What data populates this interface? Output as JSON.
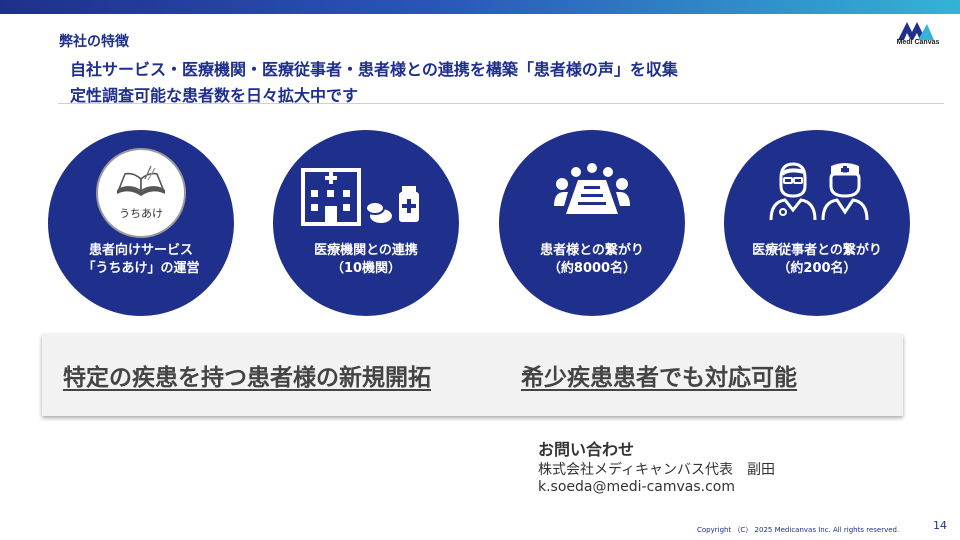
{
  "header": {
    "section_label": "弊社の特徴",
    "headline_line1": "自社サービス・医療機関・医療従事者・患者様との連携を構築「患者様の声」を収集",
    "headline_line2": "定性調査可能な患者数を日々拡大中です",
    "logo_text": "Medi Canvas"
  },
  "features": [
    {
      "label_line1": "患者向けサービス",
      "label_line2": "「うちあけ」の運営",
      "badge_text": "うちあけ",
      "icon": "book-icon"
    },
    {
      "label_line1": "医療機関との連携",
      "label_line2": "（10機関）",
      "icon": "hospital-icon"
    },
    {
      "label_line1": "患者様との繋がり",
      "label_line2": "（約8000名）",
      "icon": "meeting-icon"
    },
    {
      "label_line1": "医療従事者との繋がり",
      "label_line2": "（約200名）",
      "icon": "doctor-nurse-icon"
    }
  ],
  "highlights": {
    "left": "特定の疾患を持つ患者様の新規開拓",
    "right": "希少疾患患者でも対応可能"
  },
  "contact": {
    "title": "お問い合わせ",
    "line1": "株式会社メディキャンバス代表　副田",
    "line2": "k.soeda@medi-camvas.com"
  },
  "footer": {
    "copyright": "Copyright （C） 2025 Medicanvas Inc. All rights reserved.",
    "page_number": "14"
  },
  "colors": {
    "brand_navy": "#1f2f8c",
    "gradient_end": "#34b3d6",
    "text_gray": "#444444"
  }
}
